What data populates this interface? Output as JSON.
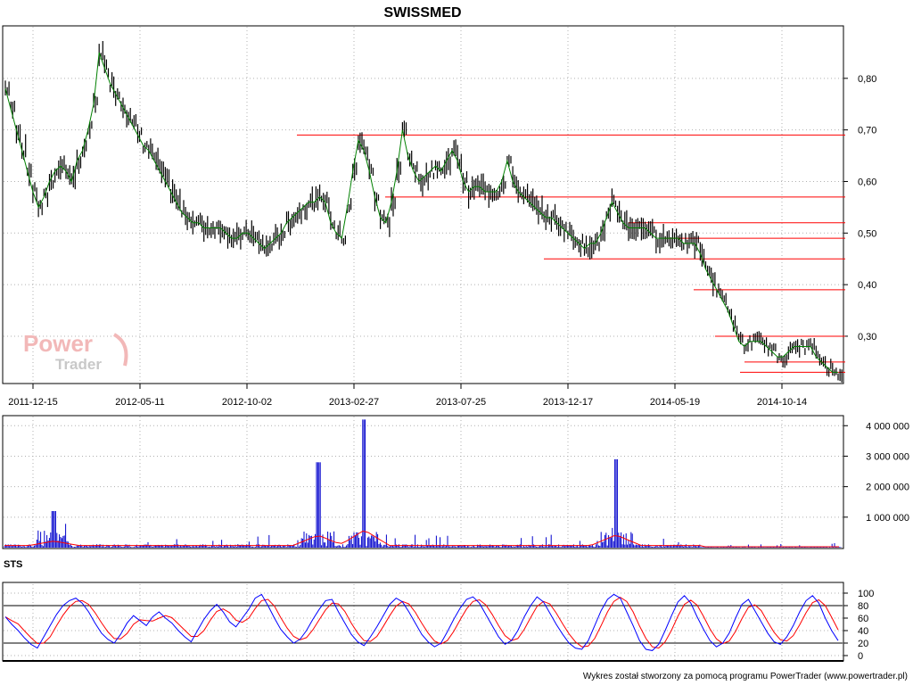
{
  "title": "SWISSMED",
  "footer": "Wykres został stworzony za pomocą programu PowerTrader (www.powertrader.pl)",
  "logo": {
    "line1": "Power",
    "line2": "Trader"
  },
  "colors": {
    "price_up": "#008000",
    "price_bar": "#000000",
    "support_lines": "#ff0000",
    "volume": "#0000cc",
    "volume_ma": "#ff0000",
    "sts_k": "#0000ff",
    "sts_d": "#ff0000",
    "grid": "#b0b0b0"
  },
  "chart_data": [
    {
      "type": "line",
      "title": "SWISSMED",
      "xlabel": "",
      "ylabel": "",
      "x_ticks": [
        "2011-12-15",
        "2012-05-11",
        "2012-10-02",
        "2013-02-27",
        "2013-07-25",
        "2013-12-17",
        "2014-05-19",
        "2014-10-14"
      ],
      "ylim": [
        0.21,
        0.9
      ],
      "y_ticks": [
        "0,30",
        "0,40",
        "0,50",
        "0,60",
        "0,70",
        "0,80"
      ],
      "series": [
        {
          "values": [
            0.78,
            0.74,
            0.7,
            0.66,
            0.62,
            0.58,
            0.55,
            0.57,
            0.6,
            0.62,
            0.63,
            0.62,
            0.6,
            0.64,
            0.66,
            0.7,
            0.75,
            0.85,
            0.82,
            0.79,
            0.77,
            0.75,
            0.73,
            0.71,
            0.69,
            0.67,
            0.66,
            0.64,
            0.62,
            0.6,
            0.58,
            0.56,
            0.54,
            0.53,
            0.52,
            0.52,
            0.51,
            0.51,
            0.51,
            0.51,
            0.5,
            0.49,
            0.49,
            0.5,
            0.5,
            0.49,
            0.48,
            0.47,
            0.48,
            0.49,
            0.5,
            0.52,
            0.53,
            0.54,
            0.55,
            0.56,
            0.56,
            0.57,
            0.56,
            0.52,
            0.5,
            0.49,
            0.55,
            0.62,
            0.68,
            0.66,
            0.62,
            0.57,
            0.53,
            0.52,
            0.56,
            0.62,
            0.7,
            0.65,
            0.62,
            0.6,
            0.61,
            0.62,
            0.63,
            0.62,
            0.64,
            0.66,
            0.64,
            0.6,
            0.58,
            0.59,
            0.59,
            0.58,
            0.58,
            0.58,
            0.6,
            0.64,
            0.6,
            0.58,
            0.57,
            0.56,
            0.55,
            0.54,
            0.53,
            0.53,
            0.52,
            0.51,
            0.5,
            0.49,
            0.48,
            0.47,
            0.48,
            0.48,
            0.5,
            0.53,
            0.56,
            0.54,
            0.52,
            0.51,
            0.51,
            0.51,
            0.51,
            0.5,
            0.49,
            0.49,
            0.49,
            0.49,
            0.49,
            0.48,
            0.48,
            0.48,
            0.46,
            0.43,
            0.41,
            0.39,
            0.37,
            0.35,
            0.32,
            0.29,
            0.28,
            0.29,
            0.29,
            0.29,
            0.28,
            0.27,
            0.26,
            0.26,
            0.27,
            0.28,
            0.28,
            0.28,
            0.28,
            0.26,
            0.25,
            0.24,
            0.23,
            0.23
          ]
        }
      ],
      "horizontal_lines": [
        0.69,
        0.57,
        0.52,
        0.49,
        0.45,
        0.39,
        0.3,
        0.25,
        0.23
      ]
    },
    {
      "type": "bar",
      "title": "",
      "ylim": [
        0,
        4300000
      ],
      "y_ticks": [
        "1 000 000",
        "2 000 000",
        "3 000 000",
        "4 000 000"
      ],
      "spikes": [
        {
          "x": 0.06,
          "value": 1200000
        },
        {
          "x": 0.375,
          "value": 2800000
        },
        {
          "x": 0.43,
          "value": 4200000
        },
        {
          "x": 0.73,
          "value": 2900000
        }
      ]
    },
    {
      "type": "line",
      "title": "STS",
      "ylim": [
        0,
        100
      ],
      "y_ticks": [
        "0",
        "20",
        "40",
        "60",
        "80",
        "100"
      ],
      "reference_lines": [
        20,
        80
      ],
      "series": [
        {
          "values": [
            62,
            50,
            40,
            28,
            18,
            12,
            30,
            48,
            66,
            80,
            88,
            92,
            84,
            70,
            52,
            36,
            26,
            20,
            34,
            52,
            64,
            56,
            48,
            62,
            70,
            60,
            52,
            40,
            30,
            22,
            40,
            58,
            72,
            82,
            70,
            54,
            46,
            60,
            74,
            92,
            98,
            80,
            60,
            42,
            30,
            20,
            26,
            40,
            58,
            74,
            88,
            90,
            70,
            52,
            34,
            22,
            16,
            30,
            46,
            64,
            82,
            92,
            86,
            70,
            52,
            34,
            22,
            14,
            20,
            38,
            58,
            76,
            90,
            94,
            84,
            66,
            48,
            30,
            18,
            24,
            40,
            62,
            80,
            94,
            86,
            68,
            50,
            34,
            20,
            12,
            10,
            24,
            48,
            72,
            90,
            98,
            92,
            70,
            48,
            24,
            10,
            8,
            18,
            40,
            64,
            86,
            96,
            84,
            62,
            42,
            24,
            14,
            20,
            36,
            60,
            82,
            90,
            72,
            54,
            36,
            22,
            18,
            30,
            48,
            70,
            88,
            96,
            84,
            60,
            40,
            24
          ]
        }
      ]
    }
  ]
}
